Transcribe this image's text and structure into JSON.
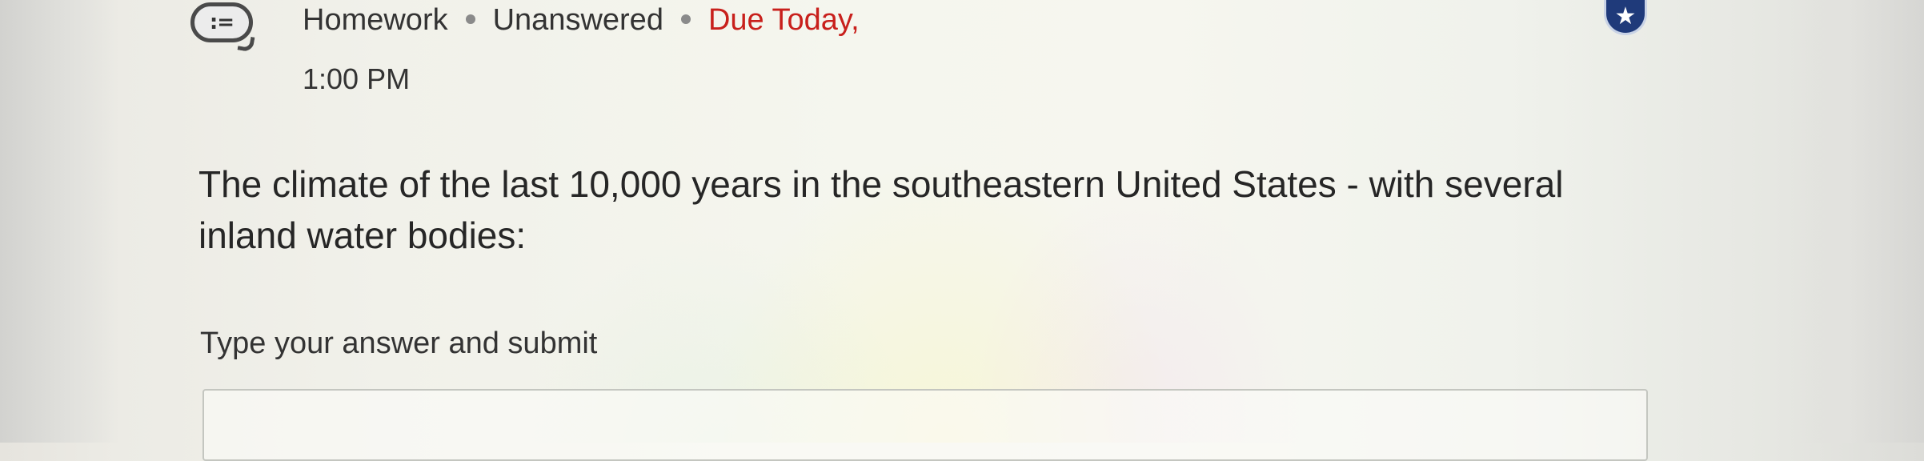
{
  "header": {
    "type_icon": "list-bubble-icon",
    "type_icon_glyph": ":=",
    "category": "Homework",
    "status": "Unanswered",
    "due": "Due Today,",
    "due_time": "1:00 PM",
    "star_icon": "star-icon",
    "star_glyph": "★"
  },
  "question": {
    "text": "The climate of the last 10,000 years in the southeastern United States - with several inland water bodies:"
  },
  "answer": {
    "label": "Type your answer and submit"
  },
  "colors": {
    "due_text": "#c8201c",
    "star_button": "#1f3a7a"
  }
}
